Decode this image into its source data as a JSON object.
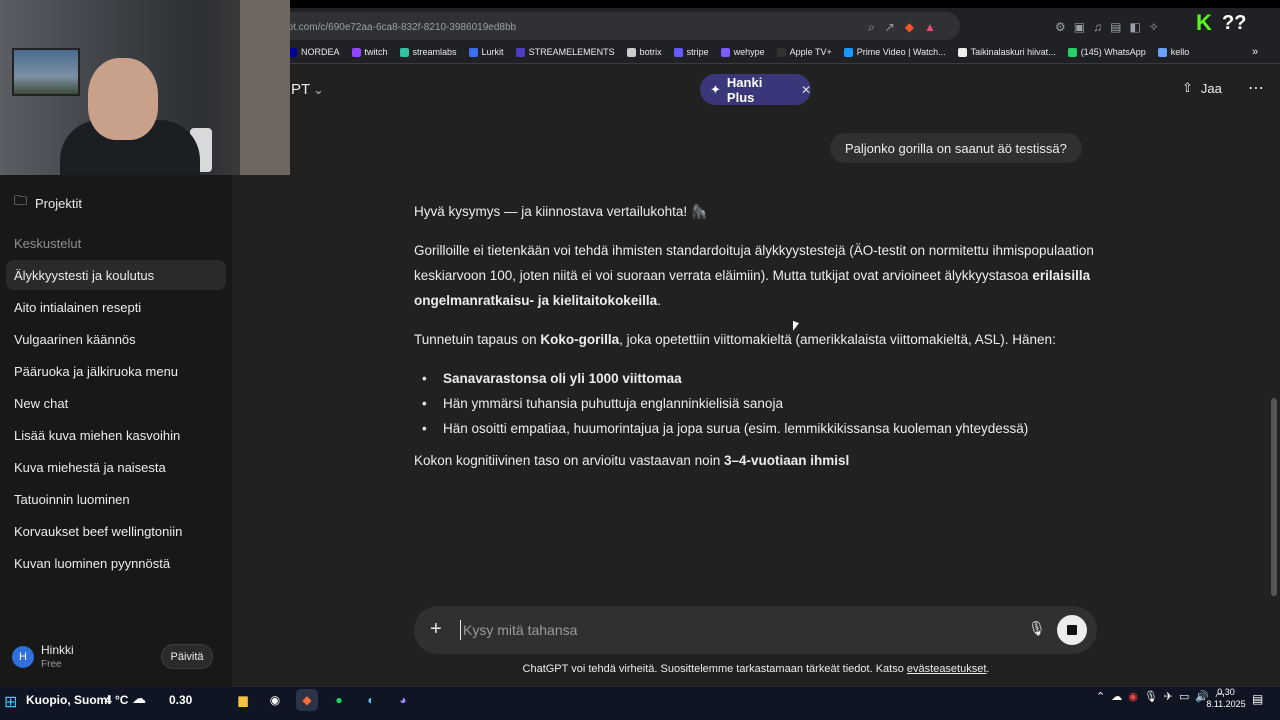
{
  "browser": {
    "url": "gpt.com/c/690e72aa-6ca8-832f-8210-3986019ed8bb",
    "bookmarks": [
      {
        "label": "NORDEA",
        "color": "#0000a0"
      },
      {
        "label": "twitch",
        "color": "#9146ff"
      },
      {
        "label": "streamlabs",
        "color": "#31c3a2"
      },
      {
        "label": "Lurkit",
        "color": "#3d6df2"
      },
      {
        "label": "STREAMELEMENTS",
        "color": "#4b3ec5"
      },
      {
        "label": "botrix",
        "color": "#cccccc"
      },
      {
        "label": "stripe",
        "color": "#635bff"
      },
      {
        "label": "wehype",
        "color": "#7b5cff"
      },
      {
        "label": "Apple TV+",
        "color": "#333333"
      },
      {
        "label": "Prime Video | Watch...",
        "color": "#1a98ff"
      },
      {
        "label": "Taikinalaskuri hiivat...",
        "color": "#eeeeee"
      },
      {
        "label": "(145) WhatsApp",
        "color": "#25d366"
      },
      {
        "label": "kello",
        "color": "#6aa0ff"
      }
    ],
    "overlay_icons": [
      "K",
      "??"
    ]
  },
  "header": {
    "title": "PT",
    "promo_label": "Hanki Plus",
    "share_label": "Jaa"
  },
  "sidebar": {
    "projects_label": "Projektit",
    "section_label": "Keskustelut",
    "items": [
      "Älykkyystesti ja koulutus",
      "Aito intialainen resepti",
      "Vulgaarinen käännös",
      "Pääruoka ja jälkiruoka menu",
      "New chat",
      "Lisää kuva miehen kasvoihin",
      "Kuva miehestä ja naisesta",
      "Tatuoinnin luominen",
      "Korvaukset beef wellingtoniin",
      "Kuvan luominen pyynnöstä"
    ],
    "user": {
      "initial": "H",
      "name": "Hinkki",
      "plan": "Free",
      "upgrade_label": "Päivitä"
    }
  },
  "chat": {
    "user_message": "Paljonko gorilla on saanut äö testissä?",
    "reply": {
      "intro": "Hyvä kysymys — ja kiinnostava vertailukohta! 🦍",
      "p1_text": "Gorilloille ei tietenkään voi tehdä ihmisten standardoituja älykkyystestejä (ÄO-testit on normitettu ihmispopulaation keskiarvoon 100, joten niitä ei voi suoraan verrata eläimiin). Mutta tutkijat ovat arvioineet älykkyystasoa ",
      "p1_bold": "erilaisilla ongelmanratkaisu- ja kielitaitokokeilla",
      "p1_end": ".",
      "p2_start": "Tunnetuin tapaus on ",
      "p2_bold": "Koko-gorilla",
      "p2_end": ", joka opetettiin viittomakieltä (amerikkalaista viittomakieltä, ASL). Hänen:",
      "bullets": [
        "Sanavarastonsa oli yli 1000 viittomaa",
        "Hän ymmärsi tuhansia puhuttuja englanninkielisiä sanoja",
        "Hän osoitti empatiaa, huumorintajua ja jopa surua (esim. lemmikkikissansa kuoleman yhteydessä)"
      ],
      "p3_start": "Kokon kognitiivinen taso on arvioitu vastaavan noin ",
      "p3_bold": "3–4-vuotiaan ihmisl"
    }
  },
  "composer": {
    "placeholder": "Kysy mitä tahansa",
    "disclaimer": "ChatGPT voi tehdä virheitä. Suosittelemme tarkastamaan tärkeät tiedot. Katso ",
    "disclaimer_link": "evästeasetukset",
    "disclaimer_end": "."
  },
  "taskbar": {
    "weather_location": "Kuopio, Suomi",
    "temperature": "4 °C",
    "weather_time": "0.30",
    "clock_time": "0.30",
    "clock_date": "8.11.2025"
  }
}
